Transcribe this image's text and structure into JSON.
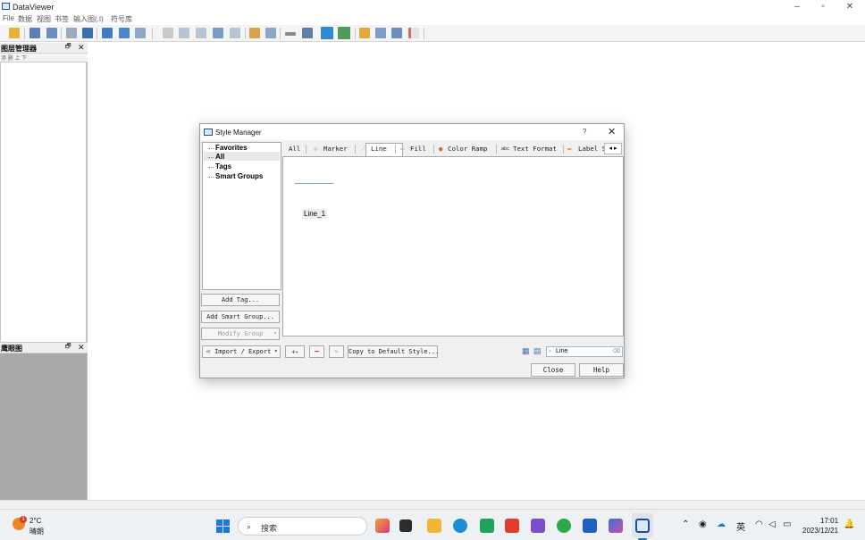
{
  "window": {
    "title": "DataViewer"
  },
  "menu": [
    "File",
    "数据",
    "视图",
    "书签",
    "输入图(.I)",
    "符号库"
  ],
  "layer_pane": {
    "title": "图层管理器",
    "tools": "添 删 上 下"
  },
  "legend_pane": {
    "title": "鹰眼图"
  },
  "dialog": {
    "title": "Style Manager",
    "help": "?",
    "groups": [
      "Favorites",
      "All",
      "Tags",
      "Smart Groups"
    ],
    "tabs": [
      "All",
      "Marker",
      "Line",
      "Fill",
      "Color Ramp",
      "Text Format",
      "Label S"
    ],
    "tab_scroll": "◂ ▸",
    "preview_item_label": "Line_1",
    "side_buttons": {
      "add_tag": "Add Tag...",
      "add_smart_group": "Add Smart Group...",
      "modify_group": "Modify Group"
    },
    "bottom_buttons": {
      "import_export": "Import / Export",
      "copy_default": "Copy to Default Style..."
    },
    "search_value": "Line",
    "close_label": "Close",
    "help_label": "Help",
    "colors": {
      "line_symbol": "#5aa8e6",
      "add": "#2e9b4a",
      "remove": "#d63a2a"
    }
  },
  "taskbar": {
    "weather_temp": "2°C",
    "weather_desc": "晴朗",
    "weather_badge": "1",
    "search_placeholder": "搜索",
    "tray_lang": "英",
    "time": "17:01",
    "date": "2023/12/21"
  }
}
